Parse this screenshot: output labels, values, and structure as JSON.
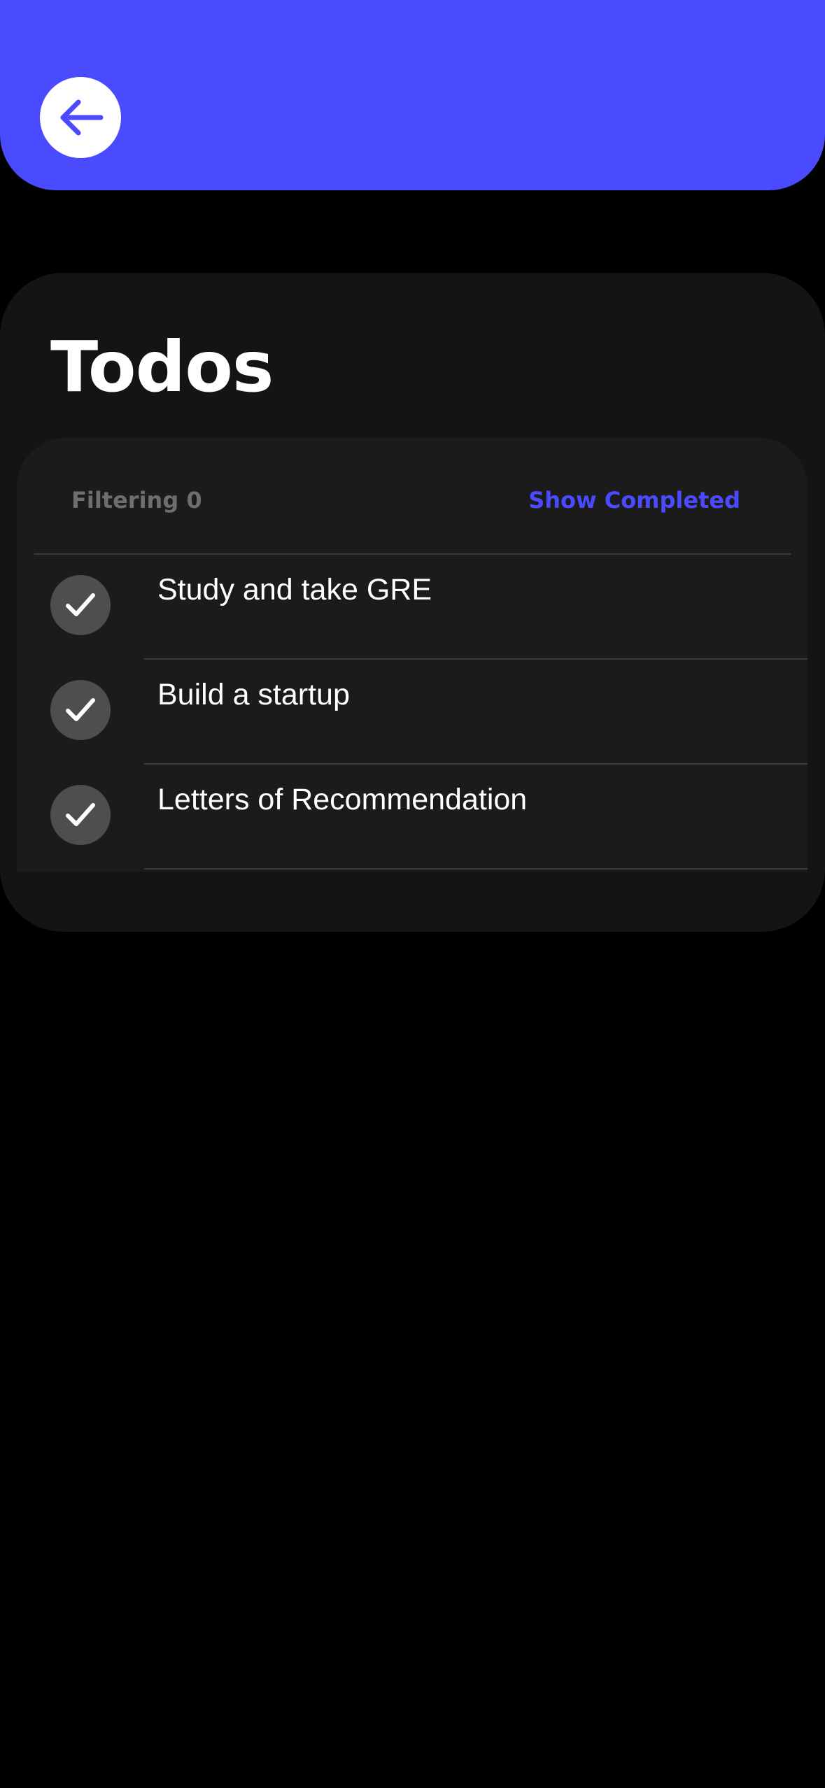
{
  "header": {
    "back_icon": "arrow-left-icon",
    "accent_color": "#4a4aff"
  },
  "title": "Todos",
  "filter": {
    "label": "Filtering 0",
    "show_completed_label": "Show Completed"
  },
  "todos": [
    {
      "text": "Study and take GRE",
      "icon": "checkmark-icon"
    },
    {
      "text": "Build a startup",
      "icon": "checkmark-icon"
    },
    {
      "text": "Letters of Recommendation",
      "icon": "checkmark-icon"
    }
  ]
}
